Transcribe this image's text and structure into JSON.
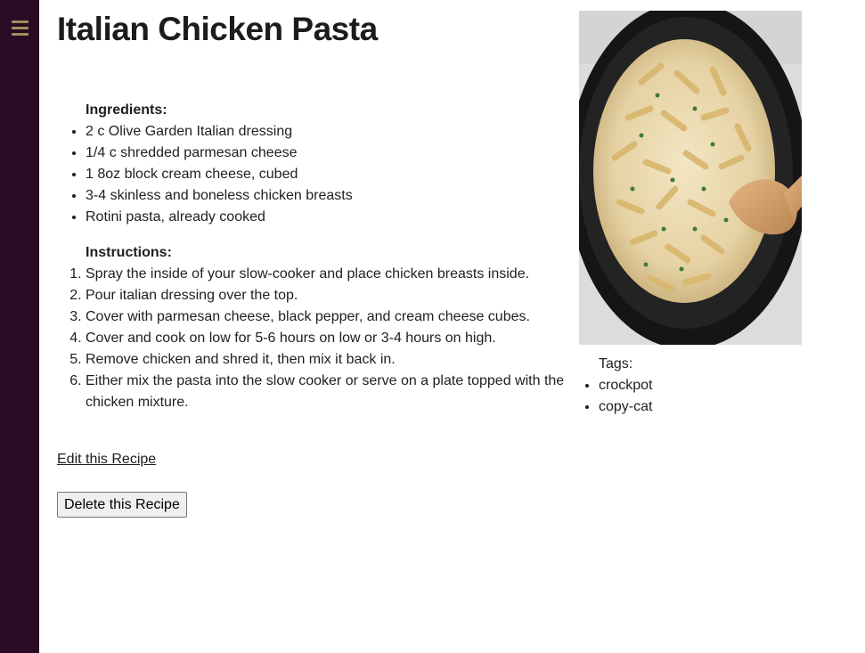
{
  "sidebar": {
    "menu_icon": "hamburger-menu-icon",
    "background": "#2b0a26",
    "icon_color": "#9c8f5a"
  },
  "recipe": {
    "title": "Italian Chicken Pasta",
    "ingredients_heading": "Ingredients:",
    "ingredients": [
      "2 c Olive Garden Italian dressing",
      "1/4 c shredded parmesan cheese",
      "1 8oz block cream cheese, cubed",
      "3-4 skinless and boneless chicken breasts",
      "Rotini pasta, already cooked"
    ],
    "instructions_heading": "Instructions:",
    "instructions": [
      "Spray the inside of your slow-cooker and place chicken breasts inside.",
      "Pour italian dressing over the top.",
      "Cover with parmesan cheese, black pepper, and cream cheese cubes.",
      "Cover and cook on low for 5-6 hours on low or 3-4 hours on high.",
      "Remove chicken and shred it, then mix it back in.",
      "Either mix the pasta into the slow cooker or serve on a plate topped with the chicken mixture."
    ]
  },
  "actions": {
    "edit_label": "Edit this Recipe",
    "delete_label": "Delete this Recipe"
  },
  "tags": {
    "heading": "Tags:",
    "items": [
      "crockpot",
      "copy-cat"
    ]
  }
}
